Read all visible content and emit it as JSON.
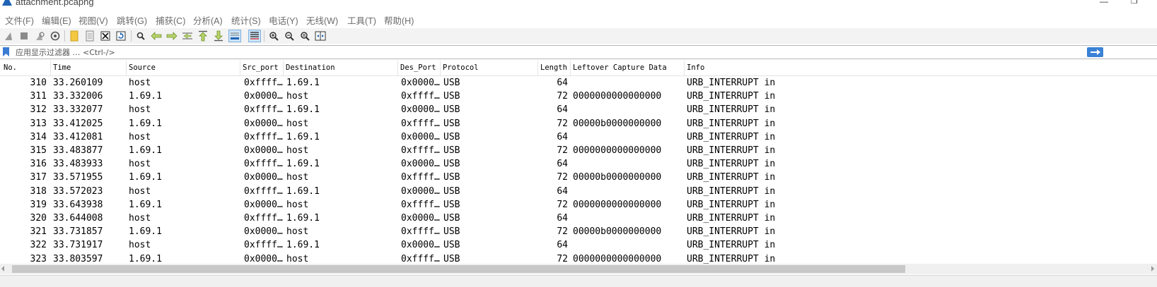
{
  "window": {
    "title": "attachment.pcapng",
    "minimize_glyph": "—",
    "maximize_glyph": "❐"
  },
  "menu": [
    "文件(F)",
    "编辑(E)",
    "视图(V)",
    "跳转(G)",
    "捕获(C)",
    "分析(A)",
    "统计(S)",
    "电话(Y)",
    "无线(W)",
    "工具(T)",
    "帮助(H)"
  ],
  "toolbar": {
    "icons": [
      "shark-fin-start-icon",
      "stop-capture-icon",
      "restart-capture-icon",
      "capture-options-icon",
      "open-file-icon",
      "save-file-icon",
      "close-file-icon",
      "reload-file-icon",
      "find-packet-icon",
      "go-back-icon",
      "go-forward-icon",
      "go-to-packet-icon",
      "go-first-icon",
      "go-last-icon",
      "autoscroll-icon",
      "colorize-icon",
      "zoom-in-icon",
      "zoom-out-icon",
      "zoom-normal-icon",
      "resize-columns-icon"
    ],
    "active": [
      "autoscroll-icon"
    ]
  },
  "filter": {
    "placeholder": "应用显示过滤器 … <Ctrl-/>",
    "value": ""
  },
  "columns": [
    "No.",
    "Time",
    "Source",
    "Src_port",
    "Destination",
    "Des_Port",
    "Protocol",
    "Length",
    "Leftover Capture Data",
    "Info"
  ],
  "rows": [
    {
      "no": "310",
      "time": "33.260109",
      "source": "host",
      "src_port": "0xffff…",
      "destination": "1.69.1",
      "des_port": "0x0000…",
      "protocol": "USB",
      "length": "64",
      "leftover": "",
      "info": "URB_INTERRUPT in"
    },
    {
      "no": "311",
      "time": "33.332006",
      "source": "1.69.1",
      "src_port": "0x0000…",
      "destination": "host",
      "des_port": "0xffff…",
      "protocol": "USB",
      "length": "72",
      "leftover": "0000000000000000",
      "info": "URB_INTERRUPT in"
    },
    {
      "no": "312",
      "time": "33.332077",
      "source": "host",
      "src_port": "0xffff…",
      "destination": "1.69.1",
      "des_port": "0x0000…",
      "protocol": "USB",
      "length": "64",
      "leftover": "",
      "info": "URB_INTERRUPT in"
    },
    {
      "no": "313",
      "time": "33.412025",
      "source": "1.69.1",
      "src_port": "0x0000…",
      "destination": "host",
      "des_port": "0xffff…",
      "protocol": "USB",
      "length": "72",
      "leftover": "00000b0000000000",
      "info": "URB_INTERRUPT in"
    },
    {
      "no": "314",
      "time": "33.412081",
      "source": "host",
      "src_port": "0xffff…",
      "destination": "1.69.1",
      "des_port": "0x0000…",
      "protocol": "USB",
      "length": "64",
      "leftover": "",
      "info": "URB_INTERRUPT in"
    },
    {
      "no": "315",
      "time": "33.483877",
      "source": "1.69.1",
      "src_port": "0x0000…",
      "destination": "host",
      "des_port": "0xffff…",
      "protocol": "USB",
      "length": "72",
      "leftover": "0000000000000000",
      "info": "URB_INTERRUPT in"
    },
    {
      "no": "316",
      "time": "33.483933",
      "source": "host",
      "src_port": "0xffff…",
      "destination": "1.69.1",
      "des_port": "0x0000…",
      "protocol": "USB",
      "length": "64",
      "leftover": "",
      "info": "URB_INTERRUPT in"
    },
    {
      "no": "317",
      "time": "33.571955",
      "source": "1.69.1",
      "src_port": "0x0000…",
      "destination": "host",
      "des_port": "0xffff…",
      "protocol": "USB",
      "length": "72",
      "leftover": "00000b0000000000",
      "info": "URB_INTERRUPT in"
    },
    {
      "no": "318",
      "time": "33.572023",
      "source": "host",
      "src_port": "0xffff…",
      "destination": "1.69.1",
      "des_port": "0x0000…",
      "protocol": "USB",
      "length": "64",
      "leftover": "",
      "info": "URB_INTERRUPT in"
    },
    {
      "no": "319",
      "time": "33.643938",
      "source": "1.69.1",
      "src_port": "0x0000…",
      "destination": "host",
      "des_port": "0xffff…",
      "protocol": "USB",
      "length": "72",
      "leftover": "0000000000000000",
      "info": "URB_INTERRUPT in"
    },
    {
      "no": "320",
      "time": "33.644008",
      "source": "host",
      "src_port": "0xffff…",
      "destination": "1.69.1",
      "des_port": "0x0000…",
      "protocol": "USB",
      "length": "64",
      "leftover": "",
      "info": "URB_INTERRUPT in"
    },
    {
      "no": "321",
      "time": "33.731857",
      "source": "1.69.1",
      "src_port": "0x0000…",
      "destination": "host",
      "des_port": "0xffff…",
      "protocol": "USB",
      "length": "72",
      "leftover": "00000b0000000000",
      "info": "URB_INTERRUPT in"
    },
    {
      "no": "322",
      "time": "33.731917",
      "source": "host",
      "src_port": "0xffff…",
      "destination": "1.69.1",
      "des_port": "0x0000…",
      "protocol": "USB",
      "length": "64",
      "leftover": "",
      "info": "URB_INTERRUPT in"
    },
    {
      "no": "323",
      "time": "33.803597",
      "source": "1.69.1",
      "src_port": "0x0000…",
      "destination": "host",
      "des_port": "0xffff…",
      "protocol": "USB",
      "length": "72",
      "leftover": "0000000000000000",
      "info": "URB_INTERRUPT in"
    }
  ],
  "colors": {
    "accent": "#3a82d6",
    "app_icon": "#1f63b5",
    "menu_text": "#6b6b6b",
    "toolbar_bg": "#f3f3f3"
  }
}
